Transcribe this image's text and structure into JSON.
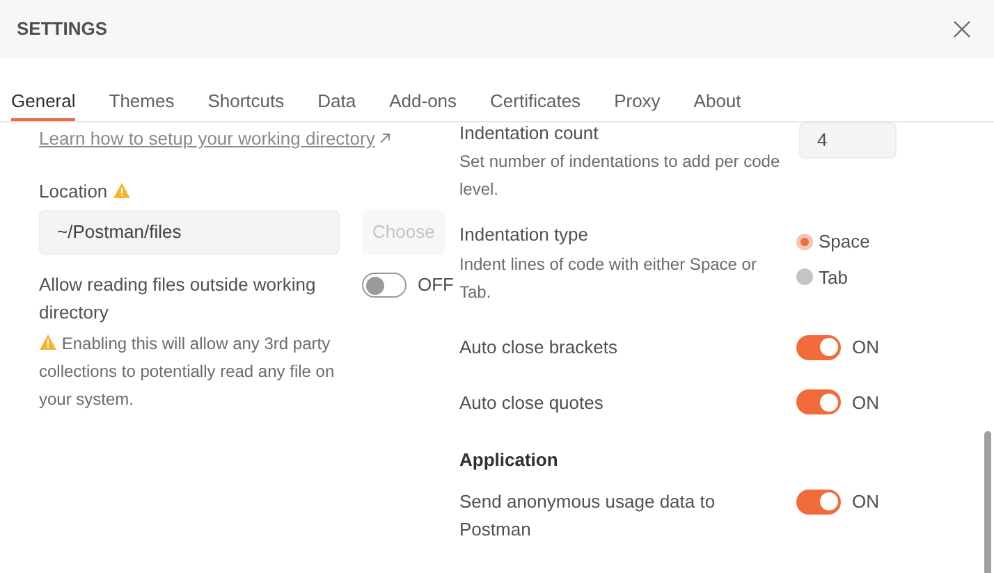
{
  "window": {
    "title": "SETTINGS"
  },
  "tabs": [
    {
      "label": "General",
      "selected": true
    },
    {
      "label": "Themes",
      "selected": false
    },
    {
      "label": "Shortcuts",
      "selected": false
    },
    {
      "label": "Data",
      "selected": false
    },
    {
      "label": "Add-ons",
      "selected": false
    },
    {
      "label": "Certificates",
      "selected": false
    },
    {
      "label": "Proxy",
      "selected": false
    },
    {
      "label": "About",
      "selected": false
    }
  ],
  "working_directory": {
    "link": "Learn how to setup your working directory",
    "location_label": "Location",
    "location_value": "~/Postman/files",
    "choose_button": "Choose",
    "choose_disabled": true,
    "allow_outside": {
      "label": "Allow reading files outside working directory",
      "on": false,
      "state_text": "OFF",
      "warning": "Enabling this will allow any 3rd party collections to potentially read any file on your system."
    }
  },
  "indentation_count": {
    "label": "Indentation count",
    "description": "Set number of indentations to add per code level.",
    "value": "4"
  },
  "indentation_type": {
    "label": "Indentation type",
    "description": "Indent lines of code with either Space or Tab.",
    "options": [
      {
        "label": "Space",
        "selected": true
      },
      {
        "label": "Tab",
        "selected": false
      }
    ]
  },
  "toggles": [
    {
      "label": "Auto close brackets",
      "on": true,
      "state_text": "ON"
    },
    {
      "label": "Auto close quotes",
      "on": true,
      "state_text": "ON"
    }
  ],
  "application": {
    "heading": "Application",
    "toggles": [
      {
        "label": "Send anonymous usage data to Postman",
        "on": true,
        "state_text": "ON"
      }
    ]
  }
}
